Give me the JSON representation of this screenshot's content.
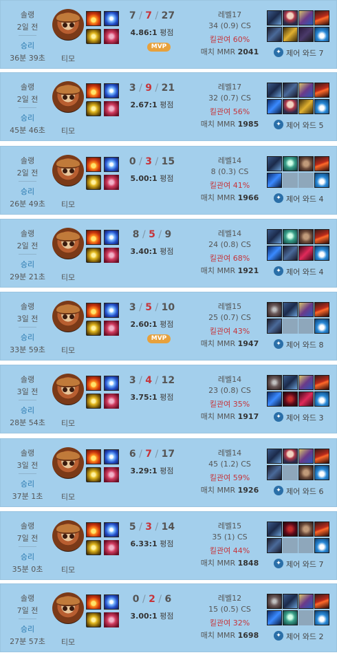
{
  "matches": [
    {
      "type": "솔랭",
      "ago": "2일 전",
      "result": "승리",
      "duration": "36분 39초",
      "champion": "티모",
      "k": "7",
      "d": "7",
      "a": "27",
      "ratio": "4.86:1",
      "ratio_suffix": "평점",
      "mvp": "MVP",
      "level": "레벨17",
      "cs": "34 (0.9) CS",
      "kp": "킬관여 60%",
      "mmr_label": "매치 MMR",
      "mmr": "2041",
      "wards": "제어 와드 7",
      "items": [
        "i-ghost",
        "i-hat",
        "i-book",
        "i-volc",
        "i-rod",
        "i-gold",
        "i-boot",
        "i-pot"
      ],
      "spells": [
        "sp-ignite",
        "sp-flash"
      ]
    },
    {
      "type": "솔랭",
      "ago": "2일 전",
      "result": "승리",
      "duration": "45분 46초",
      "champion": "티모",
      "k": "3",
      "d": "9",
      "a": "21",
      "ratio": "2.67:1",
      "ratio_suffix": "평점",
      "mvp": "",
      "level": "레벨17",
      "cs": "32 (0.7) CS",
      "kp": "킬관여 56%",
      "mmr_label": "매치 MMR",
      "mmr": "1985",
      "wards": "제어 와드 5",
      "items": [
        "i-ghost",
        "i-rod",
        "i-book",
        "i-volc",
        "i-bluetear",
        "i-hat",
        "i-gold",
        "i-pot"
      ],
      "spells": [
        "sp-ignite",
        "sp-flash"
      ]
    },
    {
      "type": "솔랭",
      "ago": "2일 전",
      "result": "승리",
      "duration": "26분 49초",
      "champion": "티모",
      "k": "0",
      "d": "3",
      "a": "15",
      "ratio": "5.00:1",
      "ratio_suffix": "평점",
      "mvp": "",
      "level": "레벨14",
      "cs": "8 (0.3) CS",
      "kp": "킬관여 41%",
      "mmr_label": "매치 MMR",
      "mmr": "1966",
      "wards": "제어 와드 4",
      "items": [
        "i-ghost",
        "i-green",
        "i-brown",
        "i-volc",
        "i-bluetear",
        "empty",
        "empty",
        "i-pot"
      ],
      "spells": [
        "sp-ignite",
        "sp-flash"
      ]
    },
    {
      "type": "솔랭",
      "ago": "2일 전",
      "result": "승리",
      "duration": "29분 21초",
      "champion": "티모",
      "k": "8",
      "d": "5",
      "a": "9",
      "ratio": "3.40:1",
      "ratio_suffix": "평점",
      "mvp": "",
      "level": "레벨14",
      "cs": "24 (0.8) CS",
      "kp": "킬관여 68%",
      "mmr_label": "매치 MMR",
      "mmr": "1921",
      "wards": "제어 와드 4",
      "items": [
        "i-ghost",
        "i-green",
        "i-brown",
        "i-volc",
        "i-bluetear",
        "i-rod",
        "i-pink",
        "i-pot"
      ],
      "spells": [
        "sp-ignite",
        "sp-flash"
      ]
    },
    {
      "type": "솔랭",
      "ago": "3일 전",
      "result": "승리",
      "duration": "33분 59초",
      "champion": "티모",
      "k": "3",
      "d": "5",
      "a": "10",
      "ratio": "2.60:1",
      "ratio_suffix": "평점",
      "mvp": "MVP",
      "level": "레벨15",
      "cs": "25 (0.7) CS",
      "kp": "킬관여 43%",
      "mmr_label": "매치 MMR",
      "mmr": "1947",
      "wards": "제어 와드 8",
      "items": [
        "i-stone",
        "i-ghost",
        "i-book",
        "i-volc",
        "i-rod",
        "empty",
        "empty",
        "i-pot"
      ],
      "spells": [
        "sp-ignite",
        "sp-flash"
      ]
    },
    {
      "type": "솔랭",
      "ago": "3일 전",
      "result": "승리",
      "duration": "28분 54초",
      "champion": "티모",
      "k": "3",
      "d": "4",
      "a": "12",
      "ratio": "3.75:1",
      "ratio_suffix": "평점",
      "mvp": "",
      "level": "레벨14",
      "cs": "23 (0.8) CS",
      "kp": "킬관여 35%",
      "mmr_label": "매치 MMR",
      "mmr": "1917",
      "wards": "제어 와드 3",
      "items": [
        "i-stone",
        "i-ghost",
        "i-book",
        "i-volc",
        "i-bluetear",
        "i-dark",
        "i-pink",
        "i-pot"
      ],
      "spells": [
        "sp-ignite",
        "sp-flash"
      ]
    },
    {
      "type": "솔랭",
      "ago": "3일 전",
      "result": "승리",
      "duration": "37분 1초",
      "champion": "티모",
      "k": "6",
      "d": "7",
      "a": "17",
      "ratio": "3.29:1",
      "ratio_suffix": "평점",
      "mvp": "",
      "level": "레벨14",
      "cs": "45 (1.2) CS",
      "kp": "킬관여 59%",
      "mmr_label": "매치 MMR",
      "mmr": "1926",
      "wards": "제어 와드 6",
      "items": [
        "i-ghost",
        "i-hat",
        "i-book",
        "i-volc",
        "i-rod",
        "empty",
        "i-brown",
        "i-pot"
      ],
      "spells": [
        "sp-ignite",
        "sp-flash"
      ]
    },
    {
      "type": "솔랭",
      "ago": "7일 전",
      "result": "승리",
      "duration": "35분 0초",
      "champion": "티모",
      "k": "5",
      "d": "3",
      "a": "14",
      "ratio": "6.33:1",
      "ratio_suffix": "평점",
      "mvp": "",
      "level": "레벨15",
      "cs": "35 (1) CS",
      "kp": "킬관여 44%",
      "mmr_label": "매치 MMR",
      "mmr": "1848",
      "wards": "제어 와드 7",
      "items": [
        "i-ghost",
        "i-dark",
        "i-brown",
        "i-volc",
        "i-rod",
        "empty",
        "empty",
        "i-pot"
      ],
      "spells": [
        "sp-ignite",
        "sp-flash"
      ]
    },
    {
      "type": "솔랭",
      "ago": "7일 전",
      "result": "승리",
      "duration": "27분 57초",
      "champion": "티모",
      "k": "0",
      "d": "2",
      "a": "6",
      "ratio": "3.00:1",
      "ratio_suffix": "평점",
      "mvp": "",
      "level": "레벨12",
      "cs": "15 (0.5) CS",
      "kp": "킬관여 32%",
      "mmr_label": "매치 MMR",
      "mmr": "1698",
      "wards": "제어 와드 2",
      "items": [
        "i-stone",
        "i-ghost",
        "i-book",
        "i-volc",
        "i-bluetear",
        "i-green",
        "empty",
        "i-pot"
      ],
      "spells": [
        "sp-ignite",
        "sp-flash"
      ]
    }
  ]
}
